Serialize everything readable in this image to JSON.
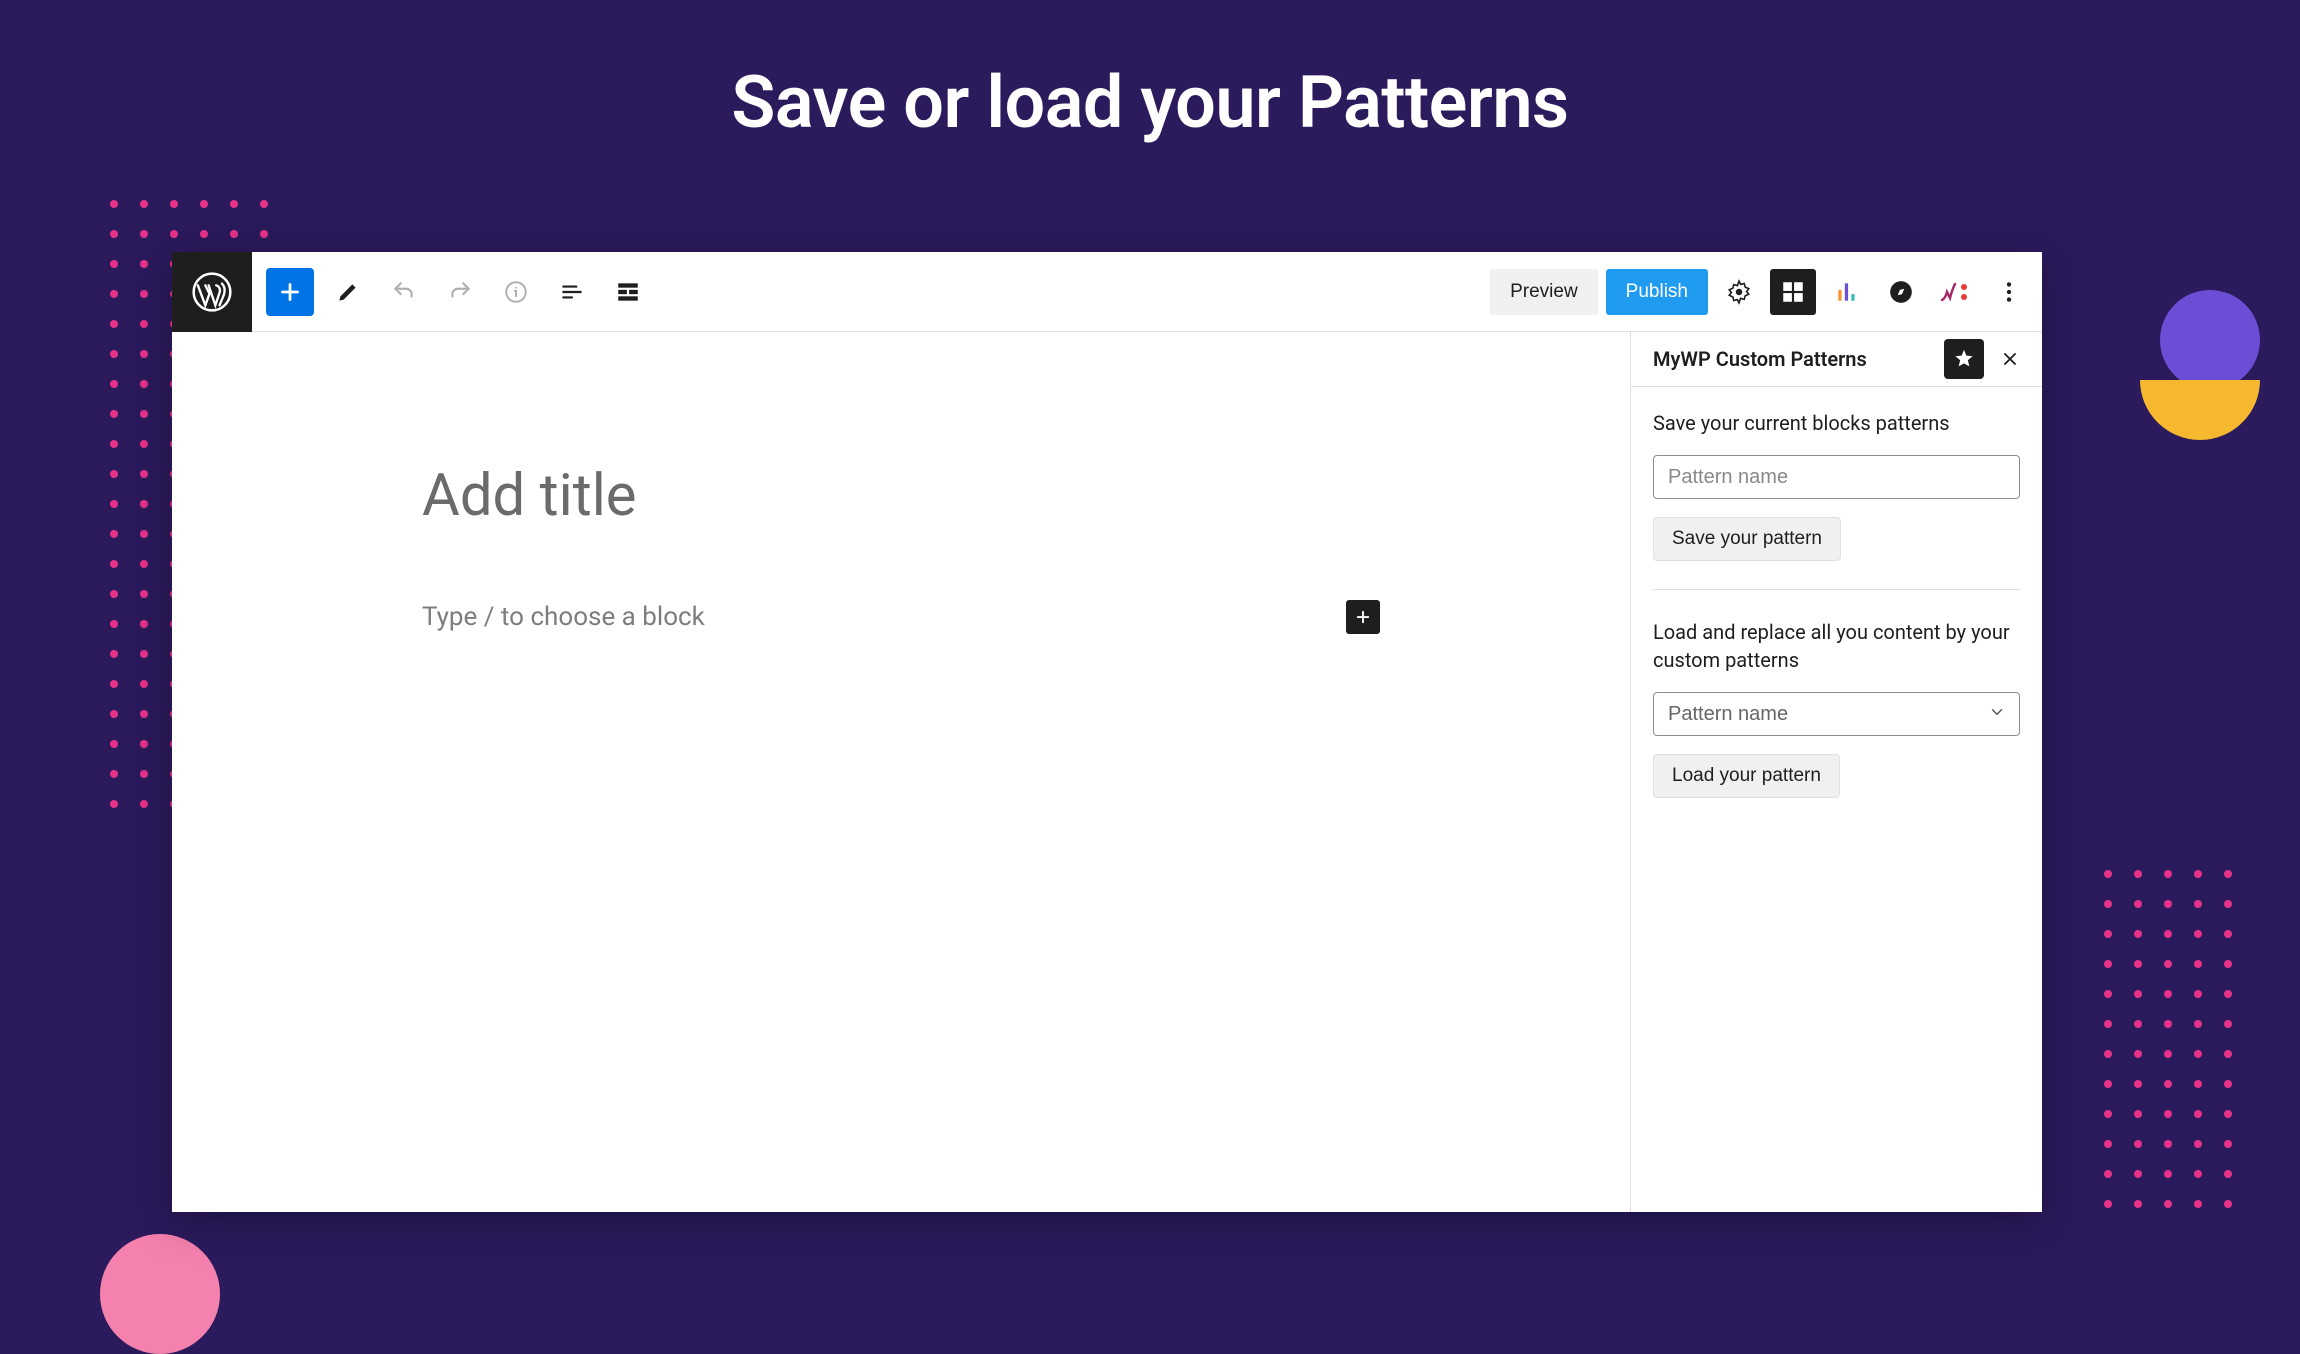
{
  "headline": "Save or load your Patterns",
  "toolbar": {
    "preview_label": "Preview",
    "publish_label": "Publish"
  },
  "editor": {
    "title_placeholder": "Add title",
    "block_prompt": "Type / to choose a block"
  },
  "panel": {
    "title": "MyWP Custom Patterns",
    "save_label": "Save your current blocks patterns",
    "input_placeholder": "Pattern name",
    "save_button": "Save your pattern",
    "load_label": "Load and replace all you content by your custom patterns",
    "select_value": "Pattern name",
    "load_button": "Load your pattern"
  }
}
